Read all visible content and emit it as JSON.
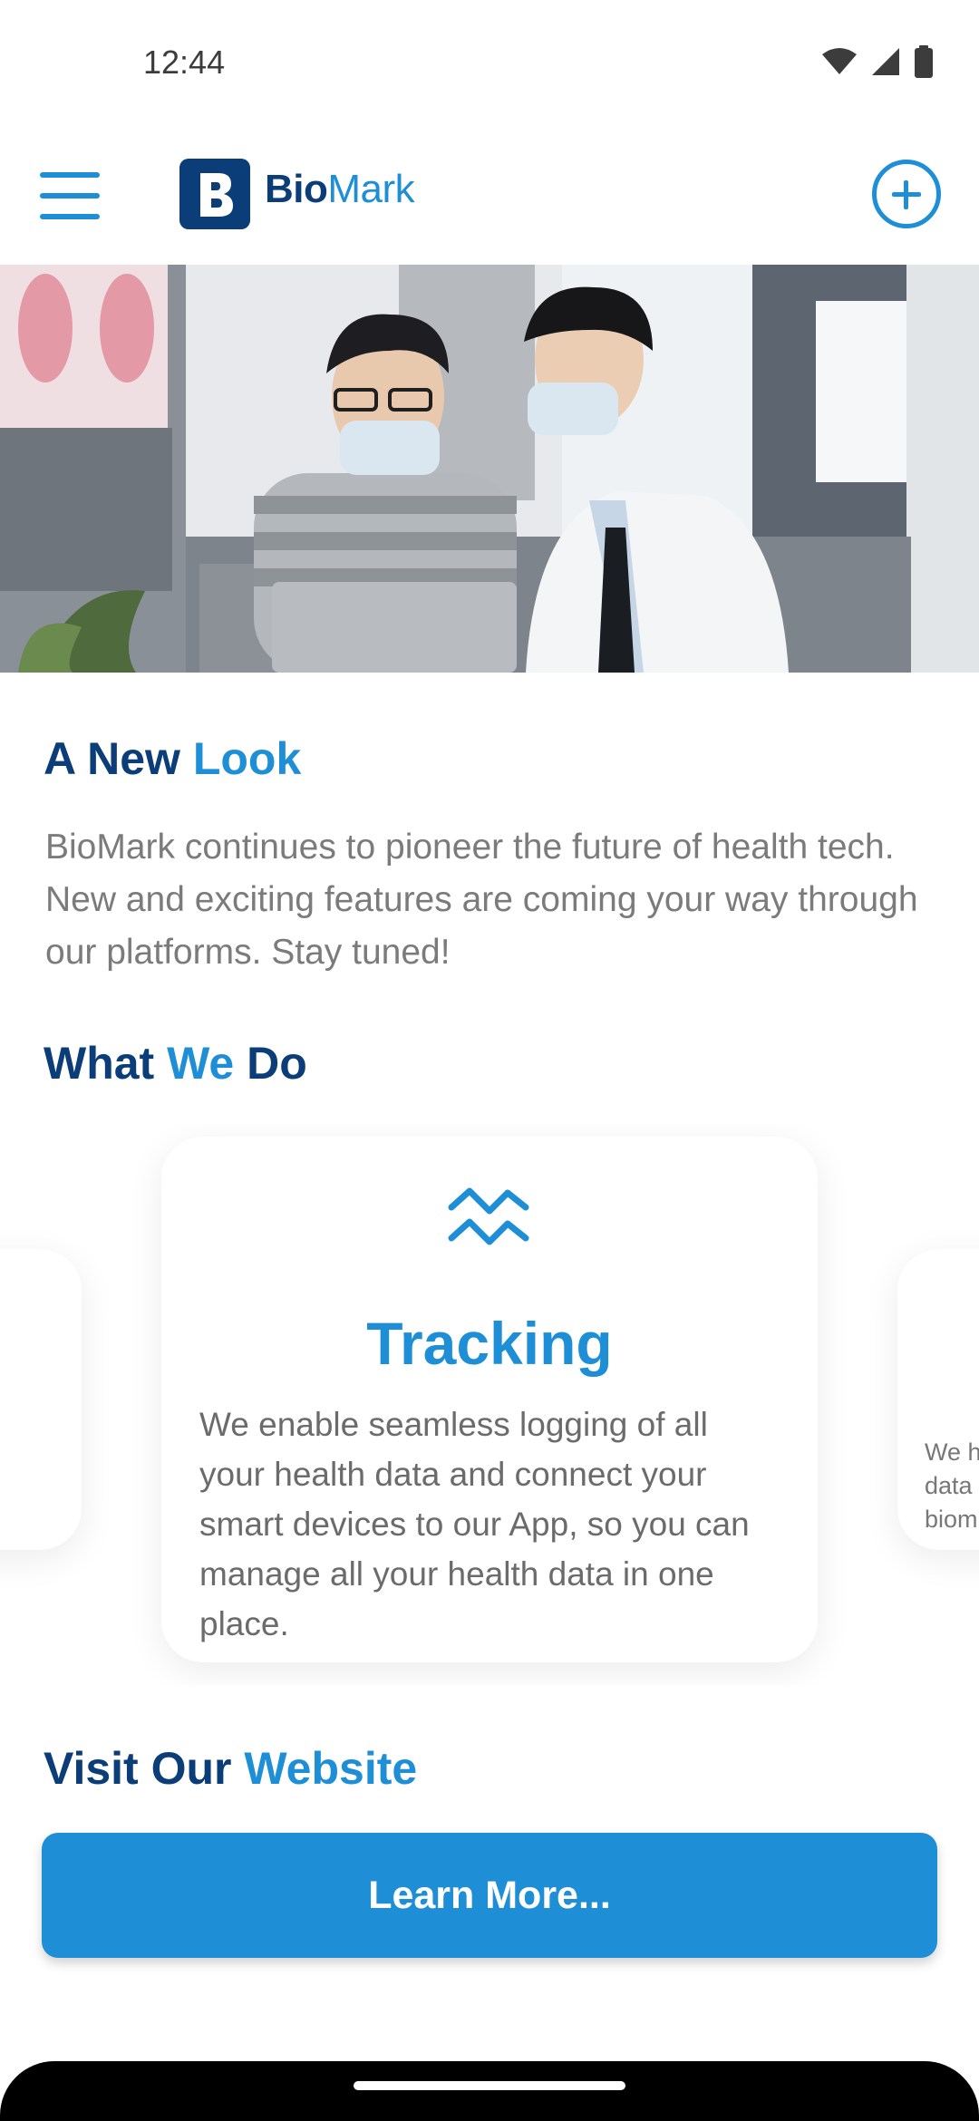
{
  "status_bar": {
    "time": "12:44"
  },
  "header": {
    "logo_bio": "Bio",
    "logo_mark": "Mark"
  },
  "intro": {
    "title_part1": "A New ",
    "title_part2": "Look",
    "body": "BioMark continues to pioneer the future of health tech. New and exciting features are coming your way through our platforms. Stay tuned!"
  },
  "what_we_do": {
    "title_part1": "What ",
    "title_part2": "We",
    "title_part3": " Do",
    "cards": [
      {
        "title": "Tracking",
        "icon": "tracking-zigzag-icon",
        "body": "We enable seamless logging of all your health data and connect your smart devices to our App, so you can manage all your health data in one place."
      }
    ],
    "right_peek_lines": [
      "We h",
      "data",
      "biom"
    ]
  },
  "website": {
    "title_part1": "Visit Our ",
    "title_part2": "Website",
    "button_label": "Learn More..."
  },
  "colors": {
    "primary_blue": "#1e8fd6",
    "navy": "#0b3d78",
    "body_gray": "#7b7b7b"
  }
}
